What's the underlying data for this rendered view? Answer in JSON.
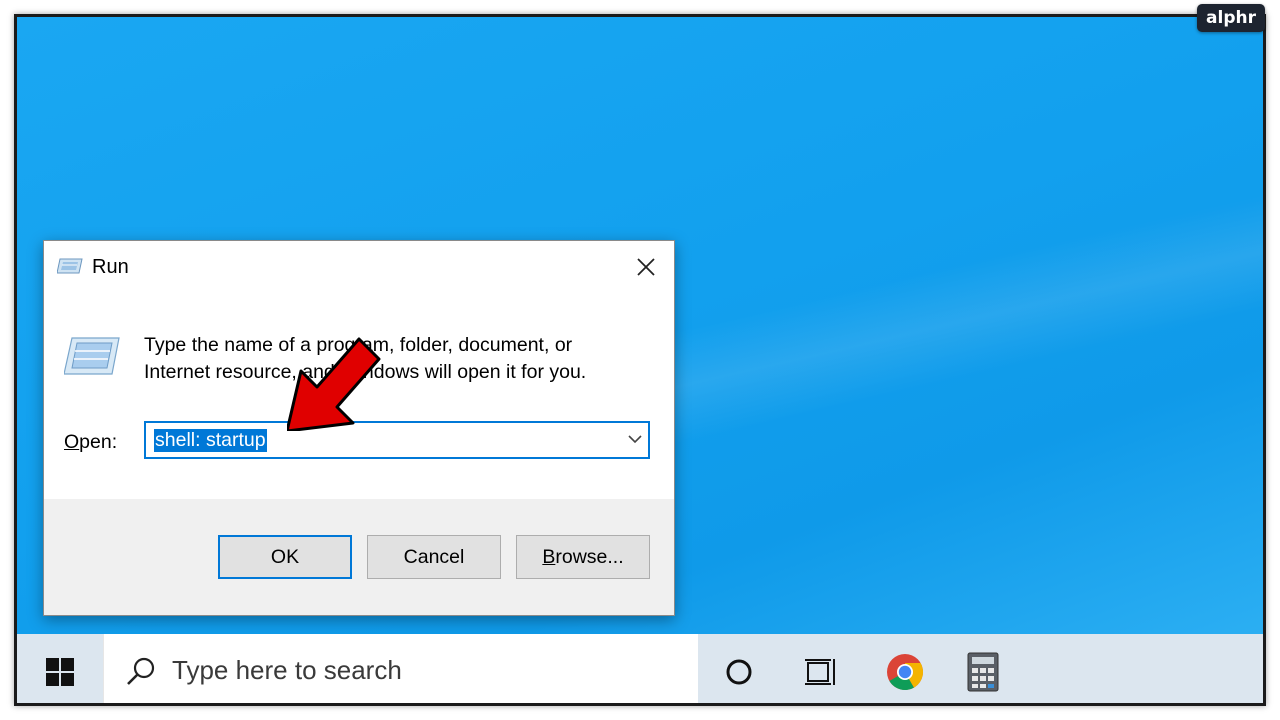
{
  "watermark": {
    "logo_text": "alphr"
  },
  "dialog": {
    "title": "Run",
    "description_line1": "Type the name of a program, folder, document, or",
    "description_line2": "Internet resource, and Windows will open it for you.",
    "open_label_mnemonic": "O",
    "open_label_rest": "pen:",
    "open_value": "shell: startup",
    "buttons": {
      "ok": "OK",
      "cancel": "Cancel",
      "browse_mnemonic": "B",
      "browse_rest": "rowse..."
    }
  },
  "annotation": {
    "icon": "red-arrow-pointer",
    "color": "#e00000"
  },
  "taskbar": {
    "search_placeholder": "Type here to search",
    "icons": [
      "windows-start-icon",
      "cortana-icon",
      "task-view-icon",
      "chrome-icon",
      "calculator-icon"
    ]
  },
  "colors": {
    "desktop": "#12a0ee",
    "accent": "#0078d7",
    "taskbar": "#dce6ef"
  }
}
